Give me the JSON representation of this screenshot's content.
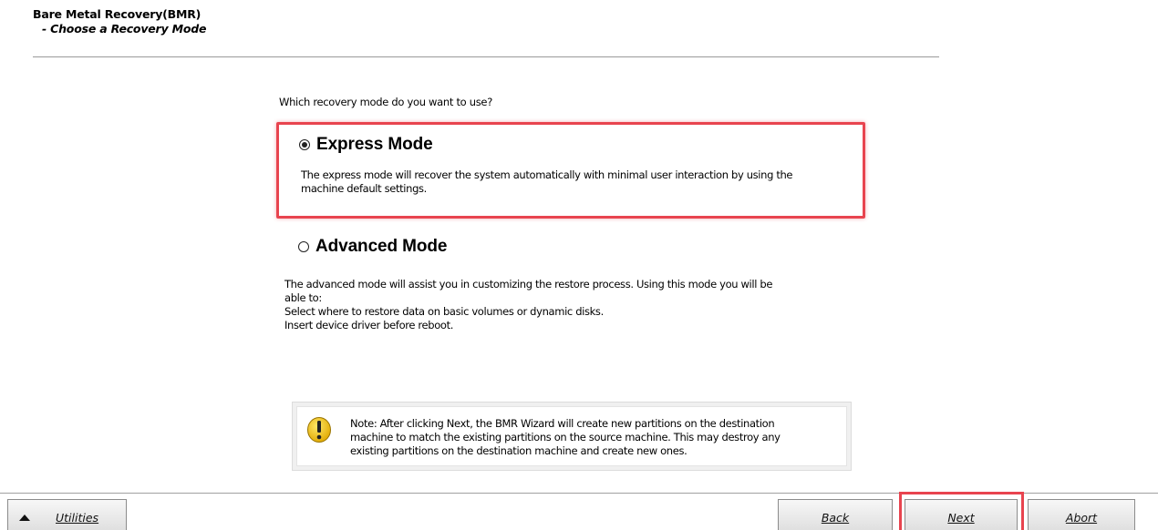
{
  "header": {
    "title": "Bare Metal Recovery(BMR)",
    "subtitle": "- Choose a Recovery Mode"
  },
  "question": "Which recovery mode do you want to use?",
  "options": {
    "express": {
      "label": "Express Mode",
      "selected": true,
      "desc_line1": "The express mode will recover the system automatically with minimal user interaction by using the",
      "desc_line2": "machine default settings."
    },
    "advanced": {
      "label": "Advanced Mode",
      "selected": false,
      "desc_line1": "The advanced mode will assist you in customizing the restore process. Using this mode you will be",
      "desc_line2": "able to:",
      "desc_line3": "Select where to restore data on basic volumes or dynamic disks.",
      "desc_line4": "Insert device driver before reboot."
    }
  },
  "note": {
    "icon": "warning-icon",
    "line1": "Note: After clicking Next, the BMR Wizard will create new partitions on the destination",
    "line2": "machine to match the existing partitions on the source machine. This may destroy any",
    "line3": "existing partitions on the destination machine and create new ones."
  },
  "footer": {
    "utilities_label": "Utilities",
    "back_label": "Back",
    "next_label": "Next",
    "abort_label": "Abort"
  },
  "colors": {
    "highlight": "#e8444f",
    "warning_fill": "#f5c400"
  }
}
